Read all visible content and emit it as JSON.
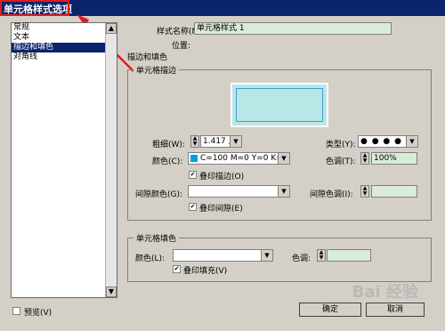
{
  "window": {
    "title": "单元格样式选项"
  },
  "sidebar": {
    "items": [
      {
        "label": "常规"
      },
      {
        "label": "文本"
      },
      {
        "label": "描边和填色",
        "selected": true
      },
      {
        "label": "对角线"
      }
    ]
  },
  "form": {
    "style_name_label": "样式名称(N):",
    "style_name_value": "单元格样式 1",
    "position_label": "位置:",
    "section_label": "描边和填色"
  },
  "stroke": {
    "group_title": "单元格描边",
    "weight_label": "粗细(W):",
    "weight_value": "1.417 点",
    "type_label": "类型(Y):",
    "type_value": "● ● ● ● ●",
    "color_label": "颜色(C):",
    "color_value": "C=100 M=0 Y=0 K=0",
    "tint_label": "色调(T):",
    "tint_value": "100%",
    "overprint_label": "叠印描边(O)",
    "gap_color_label": "间隙颜色(G):",
    "gap_tint_label": "间隙色调(I):",
    "overprint_gap_label": "叠印间隙(E)"
  },
  "fill": {
    "group_title": "单元格填色",
    "color_label": "颜色(L):",
    "tint_label": "色调:",
    "overprint_label": "叠印填充(V)"
  },
  "footer": {
    "preview_label": "预览(V)",
    "ok_label": "确定",
    "cancel_label": "取消"
  },
  "watermark": "Bai 经验",
  "colors": {
    "titlebar": "#0b246b",
    "field": "#d8ecd8",
    "highlight": "#e21c1c",
    "preview": "#b9e6e6"
  }
}
